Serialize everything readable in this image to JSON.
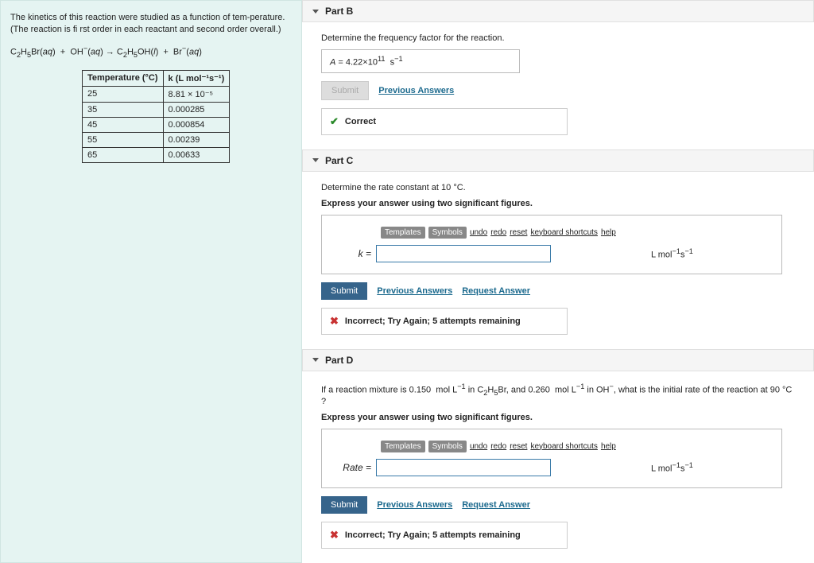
{
  "problem": {
    "intro": "The kinetics of this reaction were studied as a function of tem-perature. (The reaction is fi rst order in each reactant and second order overall.)",
    "equation_html": "C<sub>2</sub>H<sub>5</sub>Br(<i>aq</i>) &nbsp;+&nbsp; OH<sup>−</sup>(<i>aq</i>) → C<sub>2</sub>H<sub>5</sub>OH(<i>l</i>) &nbsp;+&nbsp; Br<sup>−</sup>(<i>aq</i>)",
    "table": {
      "headers": [
        "Temperature (°C)",
        "k  (L mol⁻¹s⁻¹)"
      ],
      "rows": [
        [
          "25",
          "8.81 × 10⁻⁵"
        ],
        [
          "35",
          "0.000285"
        ],
        [
          "45",
          "0.000854"
        ],
        [
          "55",
          "0.00239"
        ],
        [
          "65",
          "0.00633"
        ]
      ]
    }
  },
  "partB": {
    "label": "Part B",
    "question": "Determine the frequency factor for the reaction.",
    "answer_html": "<i>A</i> = 4.22×10<sup>11</sup> &nbsp;s<sup>−1</sup>",
    "submit": "Submit",
    "prev": "Previous Answers",
    "feedback": "Correct"
  },
  "partC": {
    "label": "Part C",
    "question_html": "Determine the rate constant at 10 °C.",
    "instruct": "Express your answer using two significant figures.",
    "var": "k =",
    "unit_html": "L mol<sup>−1</sup>s<sup>−1</sup>",
    "submit": "Submit",
    "prev": "Previous Answers",
    "request": "Request Answer",
    "feedback": "Incorrect; Try Again; 5 attempts remaining"
  },
  "partD": {
    "label": "Part D",
    "question_html": "If a reaction mixture is 0.150 &nbsp;mol L<sup>−1</sup> in C<sub>2</sub>H<sub>5</sub>Br, and 0.260 &nbsp;mol L<sup>−1</sup> in OH<sup>−</sup>, what is the initial rate of the reaction at 90 °C ?",
    "instruct": "Express your answer using two significant figures.",
    "var": "Rate =",
    "unit_html": "L mol<sup>−1</sup>s<sup>−1</sup>",
    "submit": "Submit",
    "prev": "Previous Answers",
    "request": "Request Answer",
    "feedback": "Incorrect; Try Again; 5 attempts remaining"
  },
  "toolbar": {
    "templates": "Templates",
    "symbols": "Symbols",
    "undo": "undo",
    "redo": "redo",
    "reset": "reset",
    "kbd": "keyboard shortcuts",
    "help": "help"
  }
}
